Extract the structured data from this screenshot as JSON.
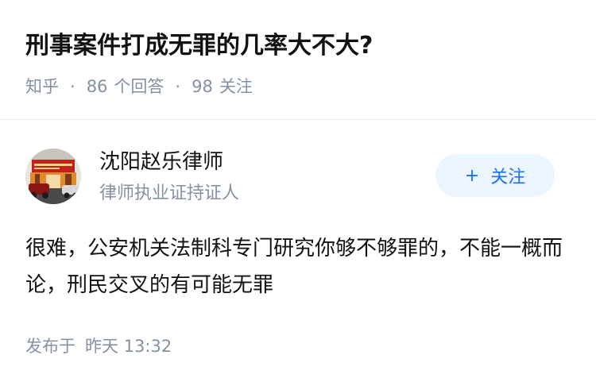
{
  "question": {
    "title": "刑事案件打成无罪的几率大不大?",
    "meta": {
      "source": "知乎",
      "answer_count": "86",
      "answer_label": "个回答",
      "follow_count": "98",
      "follow_label": "关注"
    }
  },
  "author": {
    "name": "沈阳赵乐律师",
    "badge": "律师执业证持证人",
    "avatar_icon": "law-office-storefront-photo",
    "avatar_sign_text": "辽宁省…律师事务所"
  },
  "follow_button": {
    "plus": "+",
    "label": "关注"
  },
  "answer": {
    "content": "很难，公安机关法制科专门研究你够不够罪的，不能一概而论，刑民交叉的有可能无罪"
  },
  "publish": {
    "prefix": "发布于",
    "time": "昨天 13:32"
  },
  "colors": {
    "meta_gray": "#8590a6",
    "accent_blue": "#1772f6",
    "follow_bg": "#ebf5ff",
    "text": "#121212"
  }
}
